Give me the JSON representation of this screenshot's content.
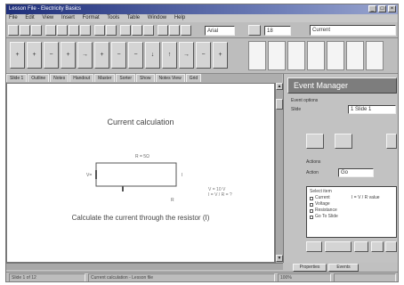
{
  "window": {
    "title": "Lesson File - Electricity Basics"
  },
  "menu": [
    "File",
    "Edit",
    "View",
    "Insert",
    "Format",
    "Tools",
    "Table",
    "Window",
    "Help"
  ],
  "toolbar": {
    "font_name": "Arial",
    "font_size": "18",
    "search_value": "Current"
  },
  "toolbar2": {
    "icons": [
      "+",
      "+",
      "−",
      "+",
      "→",
      "+",
      "−",
      "−",
      "↓",
      "↑",
      "→",
      "−",
      "+"
    ]
  },
  "tabs": [
    "Slide 1",
    "Outline",
    "Notes",
    "Handout",
    "Master",
    "Sorter",
    "Show",
    "Notes View",
    "Grid"
  ],
  "slide": {
    "title": "Current calculation",
    "question": "Calculate the current through the resistor (I)",
    "resistor_label": "R = 5Ω",
    "source_label": "V=",
    "current_label": "I",
    "bottom_label": "R",
    "note_lines": [
      "V = 10 V",
      "I = V / R = ?"
    ]
  },
  "panel": {
    "title": "Event Manager",
    "group1_label": "Event options",
    "slide_field_label": "Slide",
    "slide_field_value": "1 Slide 1",
    "group2_label": "Actions",
    "action_field_label": "Action",
    "action_field_value": "Go",
    "list_title": "Select item",
    "list_detail": "I = V / R value",
    "list_items": [
      "Current",
      "Voltage",
      "Resistance",
      "Go To Slide"
    ],
    "tabs": [
      "Properties",
      "Events"
    ]
  },
  "status": {
    "left": "Slide 1 of 12",
    "middle": "Current calculation - Lesson file",
    "right": "100%"
  },
  "colors": {
    "title_bar_start": "#1f2f7a",
    "panel_header": "#7d7d7d",
    "canvas": "#ffffff"
  }
}
